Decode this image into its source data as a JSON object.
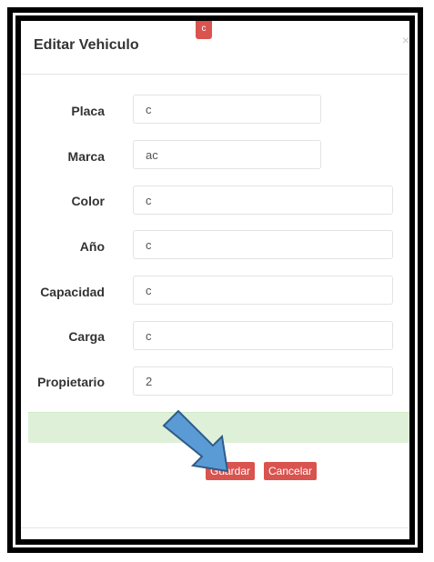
{
  "modal": {
    "title": "Editar Vehiculo",
    "badge": "c",
    "close_glyph": "×"
  },
  "form": {
    "fields": [
      {
        "label": "Placa",
        "value": "c"
      },
      {
        "label": "Marca",
        "value": "ac"
      },
      {
        "label": "Color",
        "value": "c"
      },
      {
        "label": "Año",
        "value": "c"
      },
      {
        "label": "Capacidad",
        "value": "c"
      },
      {
        "label": "Carga",
        "value": "c"
      },
      {
        "label": "Propietario",
        "value": "2"
      }
    ]
  },
  "buttons": {
    "save": "Guardar",
    "cancel": "Cancelar"
  },
  "annotation": {
    "arrow_color": "#5b9bd5",
    "icon": "arrow-pointer-icon"
  },
  "colors": {
    "danger": "#d9534f",
    "success_bg": "#dff0d8"
  }
}
